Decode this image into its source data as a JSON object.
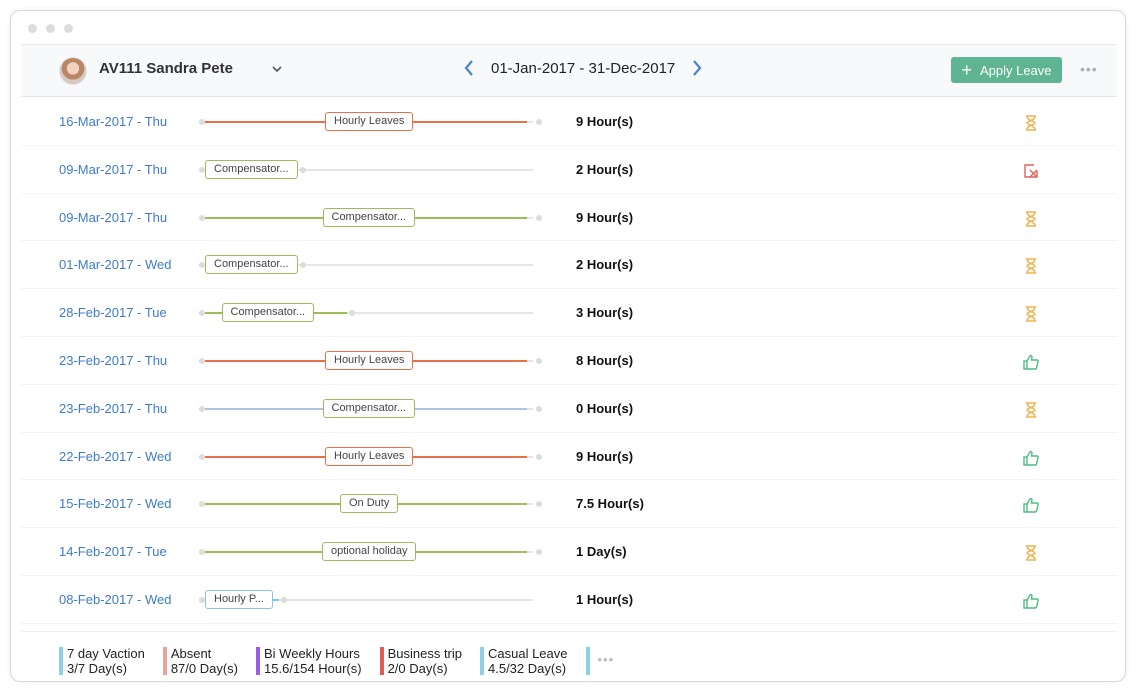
{
  "window": {
    "controls": [
      "close",
      "minimize",
      "maximize"
    ]
  },
  "header": {
    "employee": "AV111 Sandra Pete",
    "date_range": "01-Jan-2017 - 31-Dec-2017",
    "apply_label": "Apply Leave",
    "apply_icon": "plus-icon",
    "more_icon": "more-dots-icon",
    "colors": {
      "accent": "#5fb592",
      "nav_arrow": "#4a83c7"
    }
  },
  "colors": {
    "hourly": "#e8714a",
    "green": "#9bbd5a",
    "blue": "#a8c6e2",
    "light_blue": "#85c6ec",
    "pending": "#f0b44f",
    "rejected": "#d9635e",
    "approved": "#4dbb86"
  },
  "rows": [
    {
      "date": "16-Mar-2017 - Thu",
      "type": "Hourly Leaves",
      "line": "hourly",
      "fill": 1.0,
      "pill_pos": "center",
      "hours": "9 Hour(s)",
      "status": "pending"
    },
    {
      "date": "09-Mar-2017 - Thu",
      "type": "Compensator...",
      "line": "green",
      "fill": 0.0,
      "pill_pos": "start",
      "hours": "2 Hour(s)",
      "status": "rejected"
    },
    {
      "date": "09-Mar-2017 - Thu",
      "type": "Compensator...",
      "line": "green",
      "fill": 1.0,
      "pill_pos": "center",
      "hours": "9 Hour(s)",
      "status": "pending"
    },
    {
      "date": "01-Mar-2017 - Wed",
      "type": "Compensator...",
      "line": "green",
      "fill": 0.0,
      "pill_pos": "start",
      "hours": "2 Hour(s)",
      "status": "pending"
    },
    {
      "date": "28-Feb-2017 - Tue",
      "type": "Compensator...",
      "line": "green",
      "fill": 0.33,
      "pill_pos": "partial",
      "hours": "3 Hour(s)",
      "status": "pending"
    },
    {
      "date": "23-Feb-2017 - Thu",
      "type": "Hourly Leaves",
      "line": "hourly",
      "fill": 1.0,
      "pill_pos": "center",
      "hours": "8 Hour(s)",
      "status": "approved"
    },
    {
      "date": "23-Feb-2017 - Thu",
      "type": "Compensator...",
      "line": "blue",
      "fill": 1.0,
      "pill_pos": "center",
      "hours": "0 Hour(s)",
      "status": "pending"
    },
    {
      "date": "22-Feb-2017 - Wed",
      "type": "Hourly Leaves",
      "line": "hourly",
      "fill": 1.0,
      "pill_pos": "center",
      "hours": "9 Hour(s)",
      "status": "approved"
    },
    {
      "date": "15-Feb-2017 - Wed",
      "type": "On Duty",
      "line": "green",
      "fill": 1.0,
      "pill_pos": "center",
      "hours": "7.5 Hour(s)",
      "status": "approved"
    },
    {
      "date": "14-Feb-2017 - Tue",
      "type": "optional holiday",
      "line": "green",
      "fill": 1.0,
      "pill_pos": "center",
      "hours": "1 Day(s)",
      "status": "pending"
    },
    {
      "date": "08-Feb-2017 - Wed",
      "type": "Hourly P...",
      "line": "light_blue",
      "fill": 0.11,
      "pill_pos": "partial",
      "hours": "1 Hour(s)",
      "status": "approved"
    }
  ],
  "legend": [
    {
      "name": "7 day Vaction",
      "value": "3/7 Day(s)",
      "color": "#8fcfe9"
    },
    {
      "name": "Absent",
      "value": "87/0 Day(s)",
      "color": "#e8a3a0"
    },
    {
      "name": "Bi Weekly Hours",
      "value": "15.6/154 Hour(s)",
      "color": "#9b5de5"
    },
    {
      "name": "Business trip",
      "value": "2/0 Day(s)",
      "color": "#e05a5a"
    },
    {
      "name": "Casual Leave",
      "value": "4.5/32 Day(s)",
      "color": "#8fcfe9"
    }
  ],
  "legend_more": {
    "icon": "more-dots-icon",
    "color": "#8fcfe9"
  }
}
